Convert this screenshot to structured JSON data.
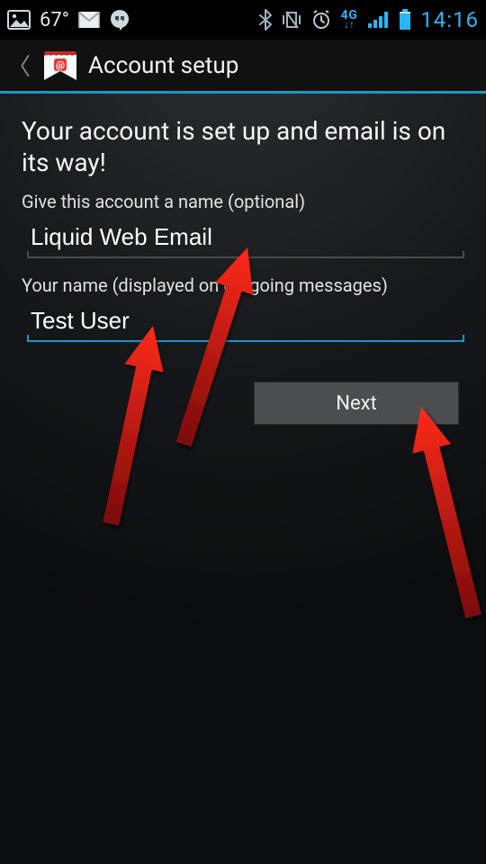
{
  "status_bar": {
    "temperature": "67°",
    "clock": "14:16",
    "network_label_top": "4G",
    "network_label_bottom": "↓↑",
    "icons": {
      "picture": "picture-icon",
      "gmail": "gmail-icon",
      "hangouts": "hangouts-icon",
      "bluetooth": "bluetooth-icon",
      "vibrate": "vibrate-icon",
      "alarm": "alarm-icon",
      "signal": "signal-icon",
      "battery": "battery-icon"
    }
  },
  "title_bar": {
    "title": "Account setup"
  },
  "content": {
    "headline": "Your account is set up and email is on its way!",
    "account_name_label": "Give this account a name (optional)",
    "account_name_value": "Liquid Web Email",
    "your_name_label": "Your name (displayed on outgoing messages)",
    "your_name_value": "Test User",
    "next_button_label": "Next"
  },
  "colors": {
    "accent": "#1e95c6",
    "clock": "#29b6f6"
  }
}
